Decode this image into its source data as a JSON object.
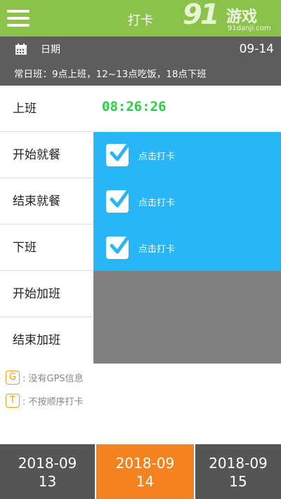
{
  "header": {
    "title": "打卡",
    "watermark": {
      "brand_digits": "91",
      "brand_cn": "游戏",
      "url": "91danji.com"
    }
  },
  "info": {
    "date_label": "日期",
    "date_value": "09-14",
    "shift_text": "常日班：9点上班，12~13点吃饭，18点下班"
  },
  "rows": [
    {
      "label": "上班",
      "time": "08:26:26"
    },
    {
      "label": "开始就餐",
      "action": "点击打卡"
    },
    {
      "label": "结束就餐",
      "action": "点击打卡"
    },
    {
      "label": "下班",
      "action": "点击打卡"
    },
    {
      "label": "开始加班"
    },
    {
      "label": "结束加班"
    }
  ],
  "legend": [
    {
      "badge": "G",
      "text": ": 没有GPS信息"
    },
    {
      "badge": "T",
      "text": ": 不按顺序打卡"
    }
  ],
  "dates": {
    "prev": {
      "line1": "2018-09",
      "line2": "13"
    },
    "current": {
      "line1": "2018-09",
      "line2": "14"
    },
    "next": {
      "line1": "2018-09",
      "line2": "15"
    }
  },
  "colors": {
    "header_bg": "#8bc34a",
    "info_bg": "#5d5d5d",
    "action_blue": "#29b6f6",
    "disabled_gray": "#808080",
    "time_green": "#2ecc40",
    "current_date_orange": "#f5821f",
    "legend_orange": "#f39c12"
  },
  "icons": {
    "menu": "hamburger-menu-icon",
    "calendar": "calendar-icon",
    "check": "checkbox-checked-icon"
  }
}
